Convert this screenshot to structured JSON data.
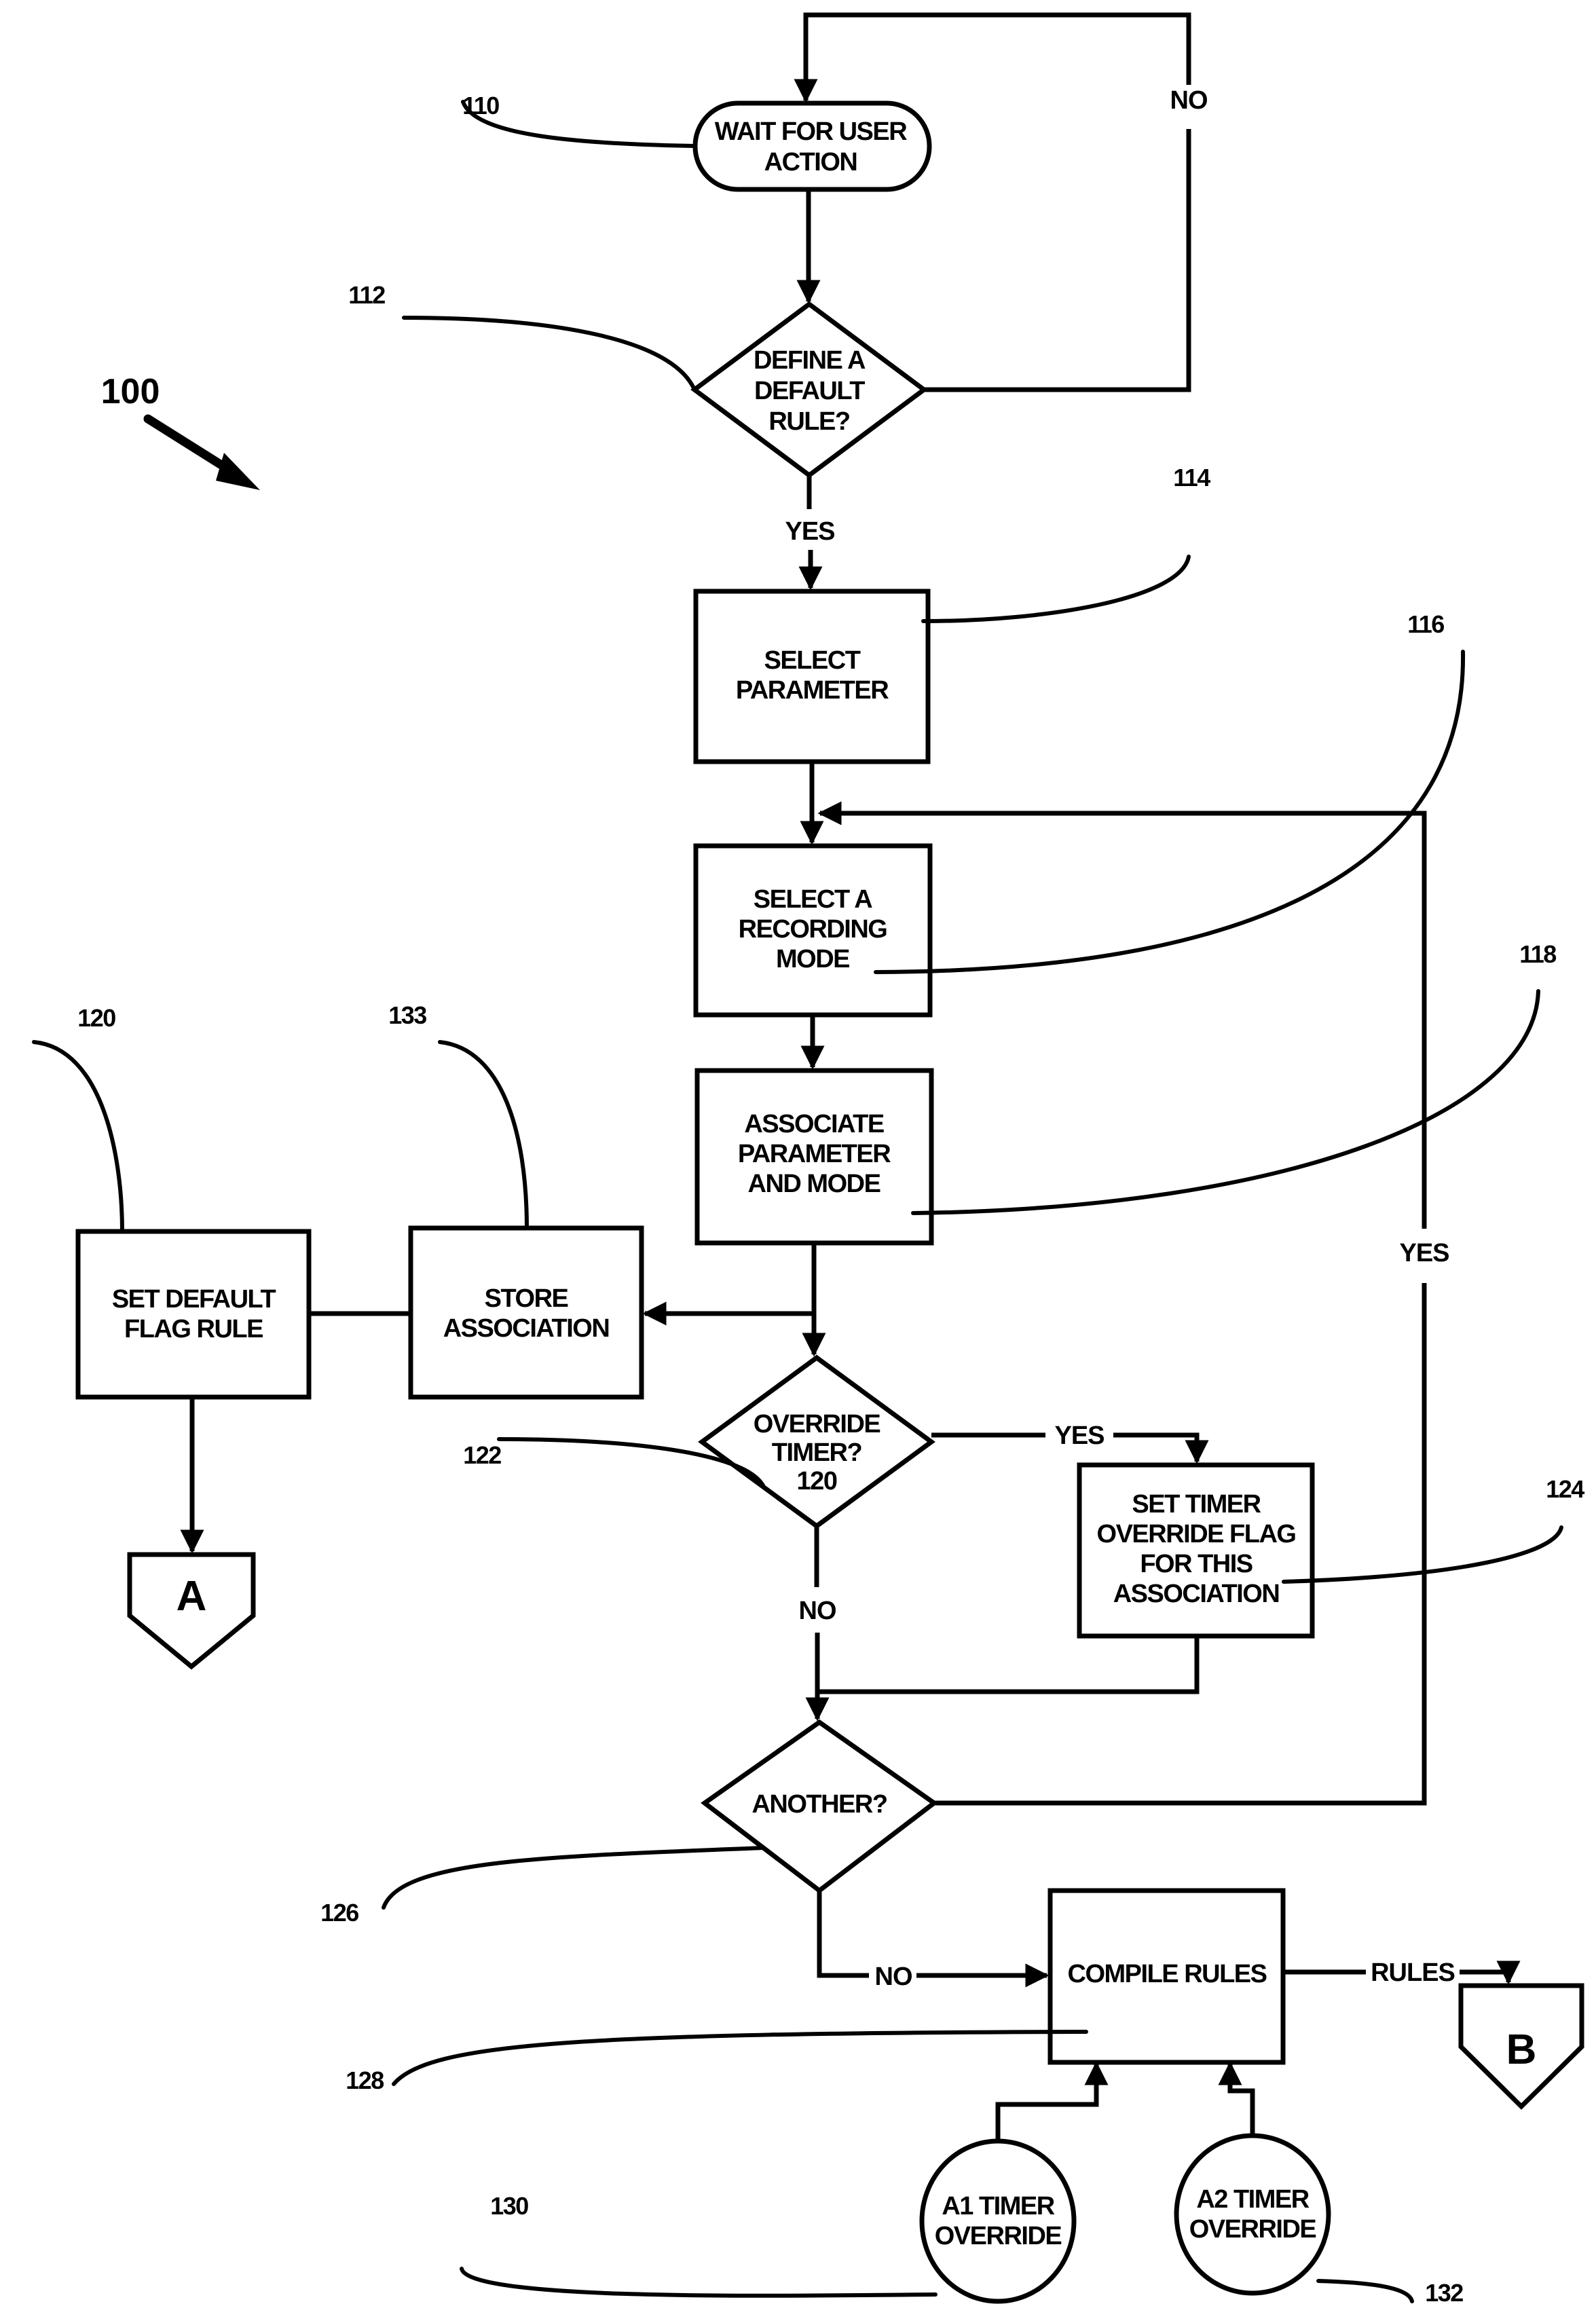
{
  "figure": {
    "ref": "100",
    "nodes": {
      "wait": {
        "ref": "110",
        "lines": [
          "WAIT FOR USER",
          "ACTION"
        ]
      },
      "define_default": {
        "ref": "112",
        "lines": [
          "DEFINE A",
          "DEFAULT",
          "RULE?"
        ]
      },
      "select_parameter": {
        "ref": "114",
        "lines": [
          "SELECT",
          "PARAMETER"
        ]
      },
      "select_mode": {
        "ref": "116",
        "lines": [
          "SELECT A",
          "RECORDING",
          "MODE"
        ]
      },
      "associate": {
        "ref": "118",
        "lines": [
          "ASSOCIATE",
          "PARAMETER",
          "AND MODE"
        ]
      },
      "store_association": {
        "ref": "133",
        "lines": [
          "STORE",
          "ASSOCIATION"
        ]
      },
      "set_default_flag": {
        "ref": "120",
        "lines": [
          "SET DEFAULT",
          "FLAG RULE"
        ]
      },
      "override_timer": {
        "ref": "122",
        "lines": [
          "OVERRIDE",
          "TIMER?",
          "120"
        ]
      },
      "set_timer_flag": {
        "ref": "124",
        "lines": [
          "SET TIMER",
          "OVERRIDE FLAG",
          "FOR THIS",
          "ASSOCIATION"
        ]
      },
      "another": {
        "ref": "126",
        "lines": [
          "ANOTHER?"
        ]
      },
      "compile_rules": {
        "ref": "128",
        "lines": [
          "COMPILE RULES"
        ]
      },
      "a1_override": {
        "ref": "130",
        "lines": [
          "A1 TIMER",
          "OVERRIDE"
        ]
      },
      "a2_override": {
        "ref": "132",
        "lines": [
          "A2 TIMER",
          "OVERRIDE"
        ]
      },
      "connector_a": {
        "label": "A"
      },
      "connector_b": {
        "label": "B"
      }
    },
    "edges": {
      "define_no": "NO",
      "define_yes": "YES",
      "override_yes": "YES",
      "override_no": "NO",
      "another_yes": "YES",
      "another_no": "NO",
      "compile_out": "RULES"
    }
  }
}
